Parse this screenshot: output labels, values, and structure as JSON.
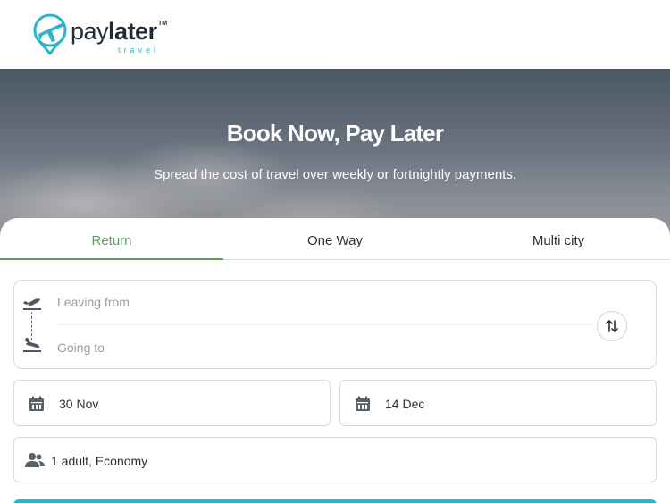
{
  "logo": {
    "pay": "pay",
    "later": "later",
    "tm": "TM",
    "sub": "travel"
  },
  "hero": {
    "title": "Book Now, Pay Later",
    "subtitle": "Spread the cost of travel over weekly or fortnightly payments."
  },
  "tabs": [
    {
      "label": "Return",
      "active": true
    },
    {
      "label": "One Way",
      "active": false
    },
    {
      "label": "Multi city",
      "active": false
    }
  ],
  "route": {
    "from_placeholder": "Leaving from",
    "to_placeholder": "Going to",
    "from_value": "",
    "to_value": ""
  },
  "dates": {
    "depart": "30 Nov",
    "return": "14 Dec"
  },
  "passengers": {
    "summary": "1 adult, Economy"
  },
  "colors": {
    "accent": "#5a9e55",
    "brand": "#2bb5c8",
    "text": "#2b2f33"
  },
  "icons": {
    "logo": "plane-pin-logo",
    "takeoff": "takeoff-icon",
    "landing": "landing-icon",
    "swap": "swap-arrows-icon",
    "calendar": "calendar-icon",
    "people": "people-icon"
  }
}
